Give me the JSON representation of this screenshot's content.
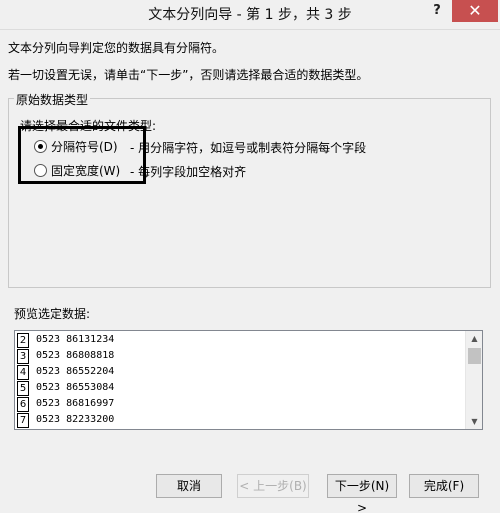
{
  "window": {
    "title": "文本分列向导 - 第 1 步，共 3 步",
    "help_label": "?",
    "close_label": "✕"
  },
  "intro": {
    "line1": "文本分列向导判定您的数据具有分隔符。",
    "line2": "若一切设置无误，请单击“下一步”，否则请选择最合适的数据类型。"
  },
  "group": {
    "title": "原始数据类型",
    "prompt": "请选择最合适的文件类型:",
    "options": [
      {
        "label": "分隔符号(D)",
        "description": "- 用分隔字符，如逗号或制表符分隔每个字段",
        "checked": true
      },
      {
        "label": "固定宽度(W)",
        "description": "- 每列字段加空格对齐",
        "checked": false
      }
    ]
  },
  "preview": {
    "label": "预览选定数据:",
    "rows": [
      {
        "num": "2",
        "text": "0523  86131234"
      },
      {
        "num": "3",
        "text": "0523  86808818"
      },
      {
        "num": "4",
        "text": "0523  86552204"
      },
      {
        "num": "5",
        "text": "0523  86553084"
      },
      {
        "num": "6",
        "text": "0523  86816997"
      },
      {
        "num": "7",
        "text": "0523  82233200"
      }
    ]
  },
  "buttons": {
    "cancel": "取消",
    "back": "< 上一步(B)",
    "next": "下一步(N) >",
    "finish": "完成(F)"
  }
}
